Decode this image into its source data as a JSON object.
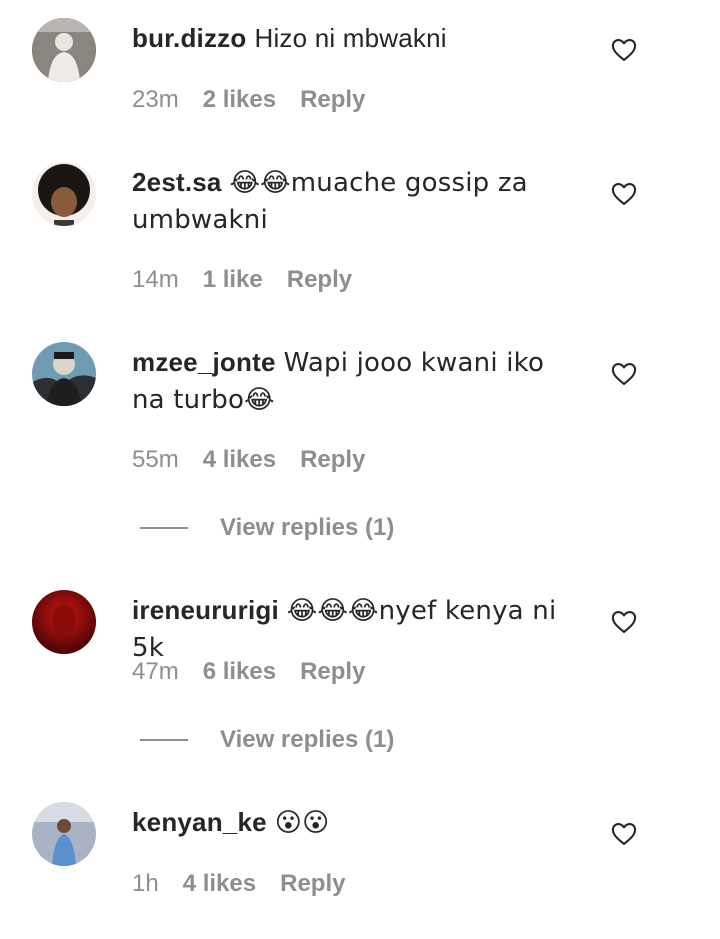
{
  "comments": [
    {
      "username": "bur.dizzo",
      "text": "Hizo ni mbwakni",
      "time": "23m",
      "likes": "2 likes",
      "reply": "Reply"
    },
    {
      "username": "2est.sa",
      "text": "😂😂muache gossip za umbwakni",
      "time": "14m",
      "likes": "1 like",
      "reply": "Reply"
    },
    {
      "username": "mzee_jonte",
      "text": "Wapi jooo kwani iko na turbo😂",
      "time": "55m",
      "likes": "4 likes",
      "reply": "Reply",
      "view_replies": "View replies (1)"
    },
    {
      "username": "ireneururigi",
      "text": "😂😂😂nyef kenya ni 5k",
      "time": "47m",
      "likes": "6 likes",
      "reply": "Reply",
      "view_replies": "View replies (1)"
    },
    {
      "username": "kenyan_ke",
      "text": "😮😮",
      "time": "1h",
      "likes": "4 likes",
      "reply": "Reply"
    }
  ],
  "icons": {
    "heart": "heart-outline-icon"
  }
}
